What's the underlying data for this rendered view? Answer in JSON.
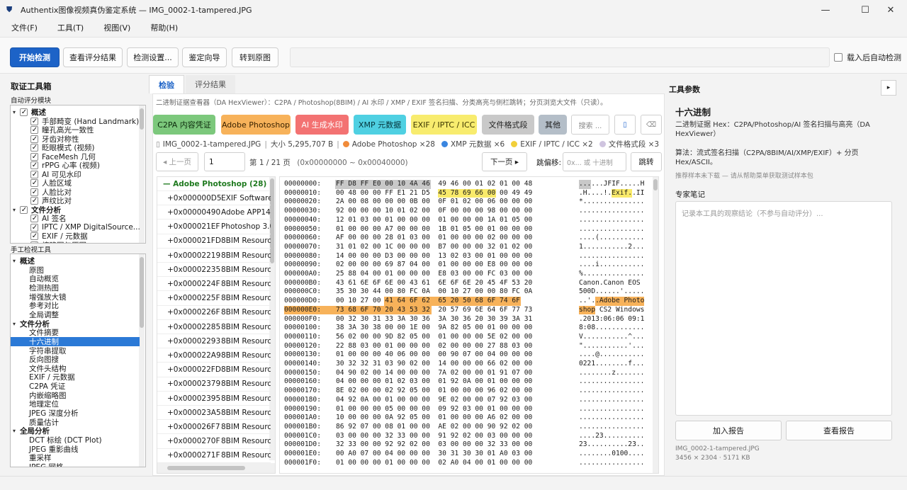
{
  "window": {
    "title": "Authentix图像视频真伪鉴定系统 — IMG_0002-1-tampered.JPG",
    "minimize": "—",
    "maximize": "☐",
    "close": "✕"
  },
  "menu": [
    "文件(F)",
    "工具(T)",
    "视图(V)",
    "帮助(H)"
  ],
  "toolbar": {
    "start": "开始检测",
    "view_scores": "查看评分结果",
    "settings": "检测设置...",
    "wizard": "鉴定向导",
    "goto_original": "转到原图",
    "auto_detect_label": "载入后自动检测",
    "auto_detect_checked": false
  },
  "left": {
    "title": "取证工具箱",
    "auto_section": "自动评分模块",
    "auto_tree": [
      {
        "label": "概述",
        "group": true,
        "checked": true
      },
      {
        "label": "手部畸变 (Hand Landmark)",
        "checked": true
      },
      {
        "label": "瞳孔高光一致性",
        "checked": true
      },
      {
        "label": "牙齿对称性",
        "checked": true
      },
      {
        "label": "眨眼模式 (视频)",
        "checked": true
      },
      {
        "label": "FaceMesh 几何",
        "checked": true
      },
      {
        "label": "rPPG 心率 (视频)",
        "checked": true
      },
      {
        "label": "AI 可见水印",
        "checked": true
      },
      {
        "label": "人脸区域",
        "checked": true
      },
      {
        "label": "人脸比对",
        "checked": true
      },
      {
        "label": "声纹比对",
        "checked": true
      },
      {
        "label": "文件分析",
        "group": true,
        "checked": true
      },
      {
        "label": "AI 签名",
        "checked": true
      },
      {
        "label": "IPTC / XMP DigitalSource...",
        "checked": true
      },
      {
        "label": "EXIF / 元数据",
        "checked": true
      },
      {
        "label": "缩略图与原图",
        "checked": true
      }
    ],
    "manual_section": "手工检视工具",
    "manual_tree": [
      {
        "label": "概述",
        "group": true
      },
      {
        "label": "原图"
      },
      {
        "label": "自动概览"
      },
      {
        "label": "检测热图"
      },
      {
        "label": "增强放大镜"
      },
      {
        "label": "参考对比"
      },
      {
        "label": "全局调整"
      },
      {
        "label": "文件分析",
        "group": true
      },
      {
        "label": "文件摘要"
      },
      {
        "label": "十六进制",
        "selected": true
      },
      {
        "label": "字符串提取"
      },
      {
        "label": "反向图搜"
      },
      {
        "label": "文件头结构"
      },
      {
        "label": "EXIF / 元数据"
      },
      {
        "label": "C2PA 凭证"
      },
      {
        "label": "内嵌缩略图"
      },
      {
        "label": "地理定位"
      },
      {
        "label": "JPEG 深度分析"
      },
      {
        "label": "质量估计"
      },
      {
        "label": "全局分析",
        "group": true
      },
      {
        "label": "DCT 标绘 (DCT Plot)"
      },
      {
        "label": "JPEG 重影曲线"
      },
      {
        "label": "重采样"
      },
      {
        "label": "JPEG 网格"
      }
    ]
  },
  "center": {
    "tabs": [
      "检验",
      "评分结果"
    ],
    "description": "二进制证据查看器（DA HexViewer）：C2PA / Photoshop(8BIM) / AI 水印 / XMP / EXIF 签名扫描、分类高亮与侧栏跳转；分页浏览大文件（只读）。",
    "chips": [
      {
        "label": "C2PA 内容凭证",
        "bg": "#7cc87c",
        "fg": "#0d2b0d"
      },
      {
        "label": "Adobe Photoshop",
        "bg": "#f7b25a",
        "fg": "#3a2200"
      },
      {
        "label": "AI 生成水印",
        "bg": "#f37272",
        "fg": "#fff"
      },
      {
        "label": "XMP 元数据",
        "bg": "#4fd0e2",
        "fg": "#05343b"
      },
      {
        "label": "EXIF / IPTC / ICC",
        "bg": "#f8ec6e",
        "fg": "#3b3500"
      },
      {
        "label": "文件格式段",
        "bg": "#c9c9c9",
        "fg": "#222"
      },
      {
        "label": "其他",
        "bg": "#b4bec8",
        "fg": "#1b1b1b"
      }
    ],
    "search_placeholder": "搜索 ...",
    "stats": {
      "file": "IMG_0002-1-tampered.JPG",
      "size": "大小 5,295,707 B",
      "items": [
        {
          "label": "Adobe Photoshop ×28",
          "color": "#f08b3a"
        },
        {
          "label": "XMP 元数据 ×6",
          "color": "#3a86e0"
        },
        {
          "label": "EXIF / IPTC / ICC ×2",
          "color": "#f1cf3a"
        },
        {
          "label": "文件格式段 ×3",
          "color": "#cfc4df"
        }
      ]
    },
    "pager": {
      "prev": "◂ 上一页",
      "page": "1",
      "page_info": "第 1 / 21 页",
      "range": "(0x00000000 ~ 0x00040000)",
      "next": "下一页 ▸",
      "jump_label": "跳偏移:",
      "jump_placeholder": "0x... 或 十进制",
      "jump_btn": "跳转"
    },
    "offsets_header": "— Adobe Photoshop   (28)",
    "offsets": [
      {
        "off": "+0x000000D5",
        "label": "EXIF Software"
      },
      {
        "off": "+0x00000490",
        "label": "Adobe APP14"
      },
      {
        "off": "+0x000021EF",
        "label": "Photoshop 3.0"
      },
      {
        "off": "+0x000021FD",
        "label": "8BIM Resource"
      },
      {
        "off": "+0x00002219",
        "label": "8BIM Resource"
      },
      {
        "off": "+0x00002235",
        "label": "8BIM Resource"
      },
      {
        "off": "+0x0000224F",
        "label": "8BIM Resource"
      },
      {
        "off": "+0x0000225F",
        "label": "8BIM Resource"
      },
      {
        "off": "+0x0000226F",
        "label": "8BIM Resource"
      },
      {
        "off": "+0x00002285",
        "label": "8BIM Resource"
      },
      {
        "off": "+0x00002293",
        "label": "8BIM Resource"
      },
      {
        "off": "+0x000022A9",
        "label": "8BIM Resource"
      },
      {
        "off": "+0x000022FD",
        "label": "8BIM Resource"
      },
      {
        "off": "+0x00002379",
        "label": "8BIM Resource"
      },
      {
        "off": "+0x00002395",
        "label": "8BIM Resource"
      },
      {
        "off": "+0x000023A5",
        "label": "8BIM Resource"
      },
      {
        "off": "+0x000026F7",
        "label": "8BIM Resource"
      },
      {
        "off": "+0x0000270F",
        "label": "8BIM Resource"
      },
      {
        "off": "+0x0000271F",
        "label": "8BIM Resource"
      }
    ],
    "hex_rows": [
      {
        "addr": "00000000:",
        "hex": "FF D8 FF E0 00 10 4A 46  49 46 00 01 02 01 00 48",
        "ascii": "......JFIF.....H"
      },
      {
        "addr": "00000010:",
        "hex": "00 48 00 00 FF E1 21 D5  45 78 69 66 00 00 49 49",
        "ascii": ".H....!.Exif..II"
      },
      {
        "addr": "00000020:",
        "hex": "2A 00 08 00 00 00 0B 00  0F 01 02 00 06 00 00 00",
        "ascii": "*..............."
      },
      {
        "addr": "00000030:",
        "hex": "92 00 00 00 10 01 02 00  0F 00 00 00 98 00 00 00",
        "ascii": "................"
      },
      {
        "addr": "00000040:",
        "hex": "12 01 03 00 01 00 00 00  01 00 00 00 1A 01 05 00",
        "ascii": "................"
      },
      {
        "addr": "00000050:",
        "hex": "01 00 00 00 A7 00 00 00  1B 01 05 00 01 00 00 00",
        "ascii": "................"
      },
      {
        "addr": "00000060:",
        "hex": "AF 00 00 00 28 01 03 00  01 00 00 00 02 00 00 00",
        "ascii": "....(..........."
      },
      {
        "addr": "00000070:",
        "hex": "31 01 02 00 1C 00 00 00  B7 00 00 00 32 01 02 00",
        "ascii": "1...........2..."
      },
      {
        "addr": "00000080:",
        "hex": "14 00 00 00 D3 00 00 00  13 02 03 00 01 00 00 00",
        "ascii": "................"
      },
      {
        "addr": "00000090:",
        "hex": "02 00 00 00 69 87 04 00  01 00 00 00 E8 00 00 00",
        "ascii": "....i..........."
      },
      {
        "addr": "000000A0:",
        "hex": "25 88 04 00 01 00 00 00  E8 03 00 00 FC 03 00 00",
        "ascii": "%..............."
      },
      {
        "addr": "000000B0:",
        "hex": "43 61 6E 6F 6E 00 43 61  6E 6F 6E 20 45 4F 53 20",
        "ascii": "Canon.Canon EOS "
      },
      {
        "addr": "000000C0:",
        "hex": "35 30 30 44 00 80 FC 0A  00 10 27 00 00 80 FC 0A",
        "ascii": "500D......'....."
      },
      {
        "addr": "000000D0:",
        "hex": "00 10 27 00 41 64 6F 62  65 20 50 68 6F 74 6F",
        "ascii": "..'..Adobe Photo"
      },
      {
        "addr": "000000E0:",
        "hex": "73 68 6F 70 20 43 53 32  20 57 69 6E 64 6F 77 73",
        "ascii": "shop CS2 Windows"
      },
      {
        "addr": "000000F0:",
        "hex": "00 32 30 31 33 3A 30 36  3A 30 36 20 30 39 3A 31",
        "ascii": ".2013:06:06 09:1"
      },
      {
        "addr": "00000100:",
        "hex": "38 3A 30 38 00 00 1E 00  9A 82 05 00 01 00 00 00",
        "ascii": "8:08............"
      },
      {
        "addr": "00000110:",
        "hex": "56 02 00 00 9D 82 05 00  01 00 00 00 5E 02 00 00",
        "ascii": "V...........^..."
      },
      {
        "addr": "00000120:",
        "hex": "22 88 03 00 01 00 00 00  02 00 00 00 27 88 03 00",
        "ascii": "\"...........'..."
      },
      {
        "addr": "00000130:",
        "hex": "01 00 00 00 40 06 00 00  00 90 07 00 04 00 00 00",
        "ascii": "....@..........."
      },
      {
        "addr": "00000140:",
        "hex": "30 32 32 31 03 90 02 00  14 00 00 00 66 02 00 00",
        "ascii": "0221........f..."
      },
      {
        "addr": "00000150:",
        "hex": "04 90 02 00 14 00 00 00  7A 02 00 00 01 91 07 00",
        "ascii": "........z......."
      },
      {
        "addr": "00000160:",
        "hex": "04 00 00 00 01 02 03 00  01 92 0A 00 01 00 00 00",
        "ascii": "................"
      },
      {
        "addr": "00000170:",
        "hex": "8E 02 00 00 02 92 05 00  01 00 00 00 96 02 00 00",
        "ascii": "................"
      },
      {
        "addr": "00000180:",
        "hex": "04 92 0A 00 01 00 00 00  9E 02 00 00 07 92 03 00",
        "ascii": "................"
      },
      {
        "addr": "00000190:",
        "hex": "01 00 00 00 05 00 00 00  09 92 03 00 01 00 00 00",
        "ascii": "................"
      },
      {
        "addr": "000001A0:",
        "hex": "10 00 00 00 0A 92 05 00  01 00 00 00 A6 02 00 00",
        "ascii": "................"
      },
      {
        "addr": "000001B0:",
        "hex": "86 92 07 00 08 01 00 00  AE 02 00 00 90 92 02 00",
        "ascii": "................"
      },
      {
        "addr": "000001C0:",
        "hex": "03 00 00 00 32 33 00 00  91 92 02 00 03 00 00 00",
        "ascii": "....23.........."
      },
      {
        "addr": "000001D0:",
        "hex": "32 33 00 00 92 92 02 00  03 00 00 00 32 33 00 00",
        "ascii": "23..........23.."
      },
      {
        "addr": "000001E0:",
        "hex": "00 A0 07 00 04 00 00 00  30 31 30 30 01 A0 03 00",
        "ascii": "........0100...."
      },
      {
        "addr": "000001F0:",
        "hex": "01 00 00 00 01 00 00 00  02 A0 04 00 01 00 00 00",
        "ascii": "................"
      }
    ]
  },
  "right": {
    "title": "工具参数",
    "expand": "▸",
    "tool_name": "十六进制",
    "tool_desc": "二进制证据 Hex：C2PA/Photoshop/AI 签名扫描与高亮（DA HexViewer）",
    "algo": "算法：流式签名扫描（C2PA/8BIM/AI/XMP/EXIF）+ 分页 Hex/ASCII。",
    "note": "推荐样本未下载 — 请从帮助菜单获取测试样本包",
    "notes_title": "专家笔记",
    "notes_placeholder": "记录本工具的观察结论（不参与自动评分）...",
    "add_report": "加入报告",
    "view_report": "查看报告",
    "file_name": "IMG_0002-1-tampered.JPG",
    "file_info": "3456 × 2304  ·  5171 KB"
  }
}
